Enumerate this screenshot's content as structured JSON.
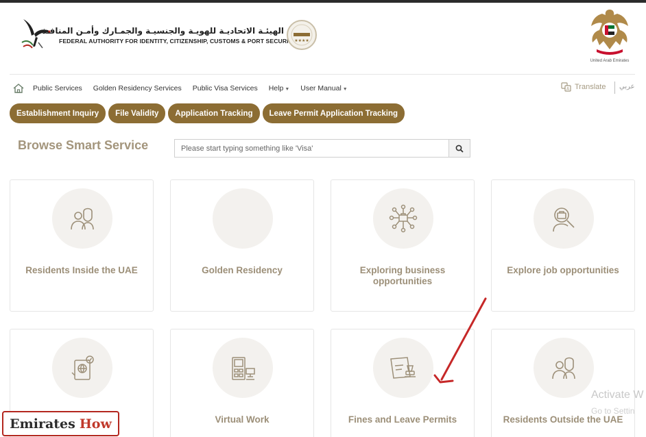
{
  "header": {
    "authority_name_ar": "الهيئـة الاتحاديـة للهويـة والجنسيـة والجمـارك وأمـن المنافـذ",
    "authority_name_en": "FEDERAL AUTHORITY FOR IDENTITY, CITIZENSHIP, CUSTOMS & PORT SECURITY",
    "emblem_caption": "United Arab Emirates"
  },
  "nav": {
    "items": [
      {
        "label": "Public Services",
        "dropdown": false
      },
      {
        "label": "Golden Residency Services",
        "dropdown": false
      },
      {
        "label": "Public Visa Services",
        "dropdown": false
      },
      {
        "label": "Help",
        "dropdown": true
      },
      {
        "label": "User Manual",
        "dropdown": true
      }
    ],
    "translate_label": "Translate",
    "language_toggle": "عربي"
  },
  "quick_links": [
    "Establishment Inquiry",
    "File Validity",
    "Application Tracking",
    "Leave Permit Application Tracking"
  ],
  "browse": {
    "title": "Browse Smart Service",
    "search_placeholder": "Please start typing something like 'Visa'"
  },
  "cards": [
    {
      "label": "Residents Inside the UAE",
      "icon": "residents-icon"
    },
    {
      "label": "Golden Residency",
      "icon": "golden-residency-icon"
    },
    {
      "label": "Exploring business opportunities",
      "icon": "business-network-icon"
    },
    {
      "label": "Explore job opportunities",
      "icon": "job-search-icon"
    },
    {
      "label": "",
      "icon": "passport-check-icon"
    },
    {
      "label": "Virtual Work",
      "icon": "virtual-work-icon"
    },
    {
      "label": "Fines and Leave Permits",
      "icon": "stamp-document-icon"
    },
    {
      "label": "Residents Outside the UAE",
      "icon": "residents-outside-icon"
    }
  ],
  "overlay": {
    "windows_activate": "Activate W",
    "windows_goto": "Go to Settin",
    "watermark_word1": "Emirates",
    "watermark_word2": "How"
  },
  "colors": {
    "accent_gold": "#8c6d34",
    "card_label": "#9c8f78",
    "title_gold": "#a3957c",
    "arrow_red": "#c62828"
  }
}
